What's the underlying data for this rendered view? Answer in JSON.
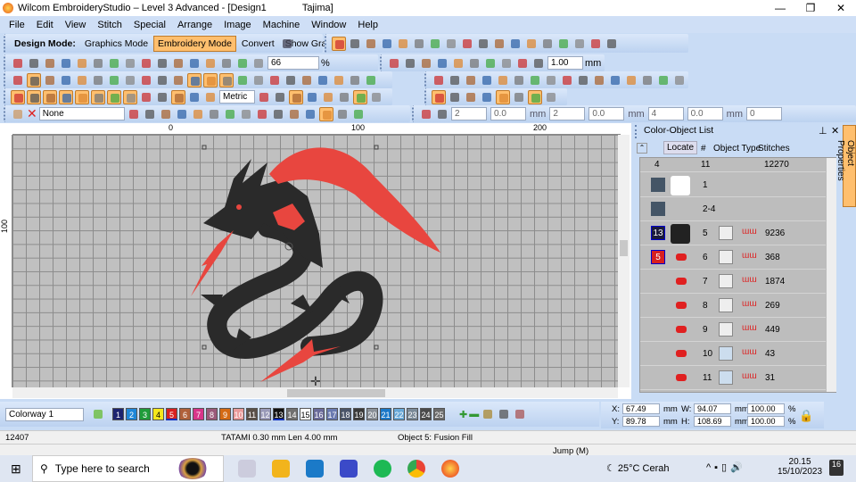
{
  "window": {
    "title": "Wilcom EmbroideryStudio – Level 3 Advanced - [Design1",
    "machine": "Tajima]",
    "controls": [
      "—",
      "❐",
      "✕"
    ]
  },
  "menu": [
    "File",
    "Edit",
    "View",
    "Stitch",
    "Special",
    "Arrange",
    "Image",
    "Machine",
    "Window",
    "Help"
  ],
  "design_mode": {
    "label": "Design Mode:",
    "graphics": "Graphics Mode",
    "embroidery": "Embroidery Mode",
    "convert": "Convert",
    "show_graphics": "Show Graphics"
  },
  "toolbars": {
    "row1_tools": [
      "select",
      "reshape",
      "pencil",
      "lettering-monogram",
      "backstitch",
      "digitize-fill",
      "closed-shape",
      "open-line",
      "polyline",
      "circle",
      "arc",
      "text",
      "team-names",
      "diamond",
      "offset",
      "elements",
      "parallel",
      "align"
    ],
    "row2_icons": [
      "new",
      "open",
      "save",
      "export",
      "print-preview",
      "print",
      "zoom-box",
      "save-as",
      "undo",
      "cut",
      "copy",
      "paste",
      "undo-arrow",
      "redo-arrow",
      "zoom",
      "zoom-out"
    ],
    "zoom_value": "66",
    "zoom_unit": "%",
    "row2b_icons": [
      "combine",
      "intersect",
      "subtract",
      "union",
      "trim",
      "outline",
      "remove-overlaps",
      "weld",
      "back",
      "front"
    ],
    "offset_value": "1.00",
    "offset_unit": "mm",
    "row3_icons": [
      "satin",
      "fill-stitch",
      "run",
      "grid",
      "stitch-angle",
      "cross",
      "wave",
      "pattern",
      "3d-fill",
      "tatami",
      "satin-wide",
      "effect",
      "contour",
      "triangle",
      "triangle2",
      "zigzag",
      "fancy",
      "wave2",
      "box",
      "lines",
      "3d",
      "ribbon",
      "emboss"
    ],
    "row3b_icons": [
      "group",
      "ungroup",
      "lock-color",
      "lock",
      "unlock",
      "align-left",
      "align-center",
      "align-right",
      "align-top",
      "align-middle",
      "align-bottom",
      "distribute-h",
      "distribute-v",
      "size",
      "width",
      "height"
    ],
    "row4_icons": [
      "shape",
      "fill",
      "outline-shape",
      "outline2",
      "line-pts",
      "pin",
      "grid-on",
      "table",
      "picture",
      "color-wheel",
      "stitch-colors",
      "ring",
      "globe"
    ],
    "units": "Metric",
    "row4b_icons": [
      "tool",
      "dots",
      "palette-grid",
      "stitch-bar",
      "window",
      "stamp",
      "reshape-nodes",
      "color-blend"
    ],
    "row4c_icons": [
      "insert",
      "crop",
      "frame",
      "checkbox",
      "needle",
      "filter",
      "reshape2",
      "color-bars"
    ],
    "row5_color_label": "None",
    "row5_icons": [
      "color-edit",
      "pattern1",
      "pattern2",
      "connect",
      "connect2",
      "connect3",
      "target",
      "grid-dots",
      "color-sphere",
      "red-dot",
      "link",
      "spread",
      "branch",
      "branch2",
      "sequence"
    ],
    "row5b_icons": [
      "fill-auto",
      "close-shape"
    ],
    "row5_fields": [
      "2",
      "0.0",
      "mm",
      "2",
      "0.0",
      "mm",
      "4",
      "0.0",
      "mm",
      "0"
    ]
  },
  "rulers": {
    "top": [
      "0",
      "100",
      "200"
    ],
    "left": [
      "100"
    ]
  },
  "panel": {
    "title": "Color-Object List",
    "locate": "Locate",
    "col_num": "#",
    "col_type": "Object Type",
    "col_stitches": "Stitches",
    "object_properties": "Object Properties",
    "summary": {
      "colors": "4",
      "objects": "11",
      "stitches": "12270"
    },
    "rows": [
      {
        "badge": "",
        "num": "1",
        "stitches": ""
      },
      {
        "badge": "",
        "num": "2-4",
        "stitches": ""
      },
      {
        "badge": "13",
        "badge_color": "#1b1b3a",
        "num": "5",
        "stitches": "9236"
      },
      {
        "badge": "5",
        "badge_color": "#d82020",
        "num": "6",
        "stitches": "368"
      },
      {
        "badge": "",
        "num": "7",
        "stitches": "1874"
      },
      {
        "badge": "",
        "num": "8",
        "stitches": "269"
      },
      {
        "badge": "",
        "num": "9",
        "stitches": "449"
      },
      {
        "badge": "",
        "num": "10",
        "stitches": "43"
      },
      {
        "badge": "",
        "num": "11",
        "stitches": "31"
      }
    ]
  },
  "colorway": "Colorway 1",
  "palette": [
    {
      "n": "1",
      "c": "#1c2370"
    },
    {
      "n": "2",
      "c": "#1f86d8"
    },
    {
      "n": "3",
      "c": "#1f9c3a"
    },
    {
      "n": "4",
      "c": "#f5e71c"
    },
    {
      "n": "5",
      "c": "#d82020"
    },
    {
      "n": "6",
      "c": "#b0603a"
    },
    {
      "n": "7",
      "c": "#d8348a"
    },
    {
      "n": "8",
      "c": "#9a5a7a"
    },
    {
      "n": "9",
      "c": "#d46a14"
    },
    {
      "n": "10",
      "c": "#e89a9a"
    },
    {
      "n": "11",
      "c": "#5a5048"
    },
    {
      "n": "12",
      "c": "#9a9ab8"
    },
    {
      "n": "13",
      "c": "#111111"
    },
    {
      "n": "14",
      "c": "#707070"
    },
    {
      "n": "15",
      "c": "#ffffff"
    },
    {
      "n": "16",
      "c": "#6a6a9a"
    },
    {
      "n": "17",
      "c": "#6a7ab0"
    },
    {
      "n": "18",
      "c": "#4a5468"
    },
    {
      "n": "19",
      "c": "#3a3a3a"
    },
    {
      "n": "20",
      "c": "#8a9098"
    },
    {
      "n": "21",
      "c": "#1a78c8"
    },
    {
      "n": "22",
      "c": "#68a8d8"
    },
    {
      "n": "23",
      "c": "#7a8a98"
    },
    {
      "n": "24",
      "c": "#4a4a4a"
    },
    {
      "n": "25",
      "c": "#6a6a6a"
    }
  ],
  "coords": {
    "x_label": "X:",
    "x": "67.49",
    "y_label": "Y:",
    "y": "89.78",
    "w_label": "W:",
    "w": "94.07",
    "h_label": "H:",
    "h": "108.69",
    "unit": "mm",
    "sx": "100.00",
    "sy": "100.00",
    "pct": "%"
  },
  "status": {
    "stitch_count": "12407",
    "stitch_type": "TATAMI  0.30 mm Len  4.00 mm",
    "object": "Object 5: Fusion Fill",
    "jump": "Jump (M)"
  },
  "taskbar": {
    "search": "Type here to search",
    "weather": "25°C  Cerah",
    "time": "20.15",
    "date": "15/10/2023",
    "notifications": "16"
  },
  "colors": {
    "thread_black": "#2a2a2a",
    "thread_red": "#e8463f"
  }
}
